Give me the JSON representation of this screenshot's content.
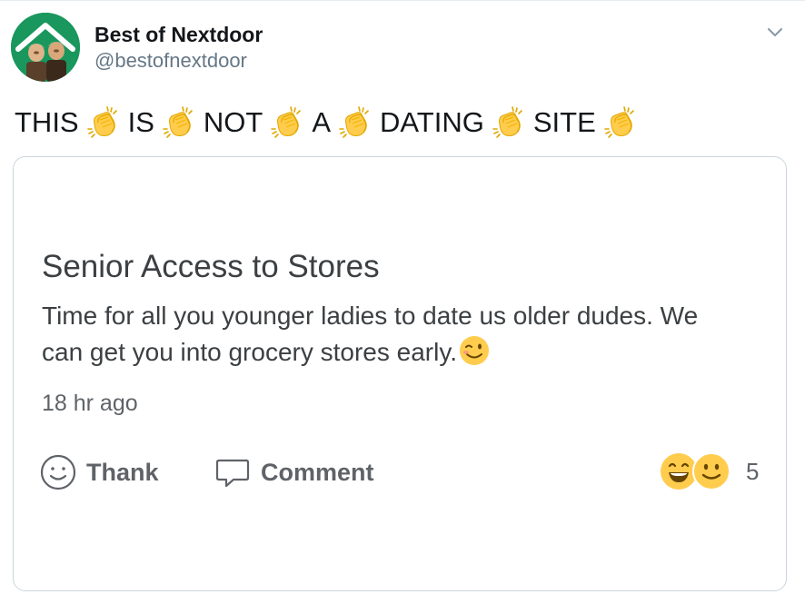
{
  "tweet": {
    "display_name": "Best of Nextdoor",
    "handle": "@bestofnextdoor",
    "text_words": [
      "THIS",
      "IS",
      "NOT",
      "A",
      "DATING",
      "SITE"
    ],
    "separator_icon": "clapping-hands-icon"
  },
  "card": {
    "title": "Senior Access to Stores",
    "body": "Time for all you younger ladies to date us older dudes. We can get you into grocery stores early.",
    "body_emoji_icon": "winking-face-icon",
    "timestamp": "18 hr ago",
    "actions": {
      "thank_label": "Thank",
      "comment_label": "Comment"
    },
    "reactions": {
      "icons": [
        "grinning-face-icon",
        "smiling-face-icon"
      ],
      "count": "5"
    }
  },
  "colors": {
    "avatar_green": "#19975d",
    "text_primary": "#14171a",
    "text_secondary": "#657786",
    "card_border": "#ccd6dd",
    "emoji_yellow": "#ffcc4d"
  }
}
